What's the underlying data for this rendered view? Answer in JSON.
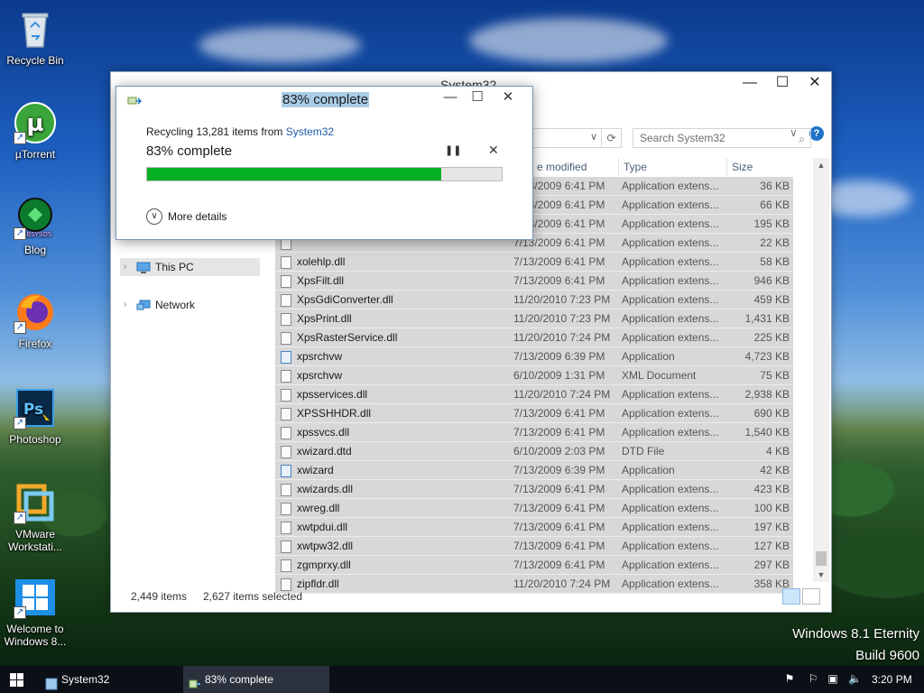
{
  "desktop": {
    "icons": [
      {
        "label": "Recycle Bin",
        "icon": "recycle-bin-icon"
      },
      {
        "label": "µTorrent",
        "icon": "utorrent-icon",
        "badge": "µ"
      },
      {
        "label": "Blog",
        "icon": "blog-icon",
        "badge": "LABSYSOS"
      },
      {
        "label": "Firefox",
        "icon": "firefox-icon"
      },
      {
        "label": "Photoshop",
        "icon": "photoshop-icon",
        "badge": "Ps"
      },
      {
        "label": "VMware Workstati...",
        "icon": "vmware-icon"
      },
      {
        "label": "Welcome to Windows 8...",
        "icon": "windows-welcome-icon"
      }
    ],
    "watermark": {
      "line1": "Windows 8.1 Eternity",
      "line2": "Build 9600"
    }
  },
  "explorer": {
    "title": "System32",
    "search_placeholder": "Search System32",
    "help_label": "?",
    "columns": {
      "date": "e modified",
      "type": "Type",
      "size": "Size"
    },
    "nav": [
      {
        "label": "This PC",
        "selected": true,
        "icon": "this-pc-icon"
      },
      {
        "label": "Network",
        "selected": false,
        "icon": "network-icon"
      }
    ],
    "files": [
      {
        "name": "",
        "date": "7/13/2009 6:41 PM",
        "type": "Application extens...",
        "size": "36 KB",
        "icon": "dll"
      },
      {
        "name": "",
        "date": "7/13/2009 6:41 PM",
        "type": "Application extens...",
        "size": "66 KB",
        "icon": "dll"
      },
      {
        "name": "",
        "date": "7/13/2009 6:41 PM",
        "type": "Application extens...",
        "size": "195 KB",
        "icon": "dll"
      },
      {
        "name": "",
        "date": "7/13/2009 6:41 PM",
        "type": "Application extens...",
        "size": "22 KB",
        "icon": "dll"
      },
      {
        "name": "xolehlp.dll",
        "date": "7/13/2009 6:41 PM",
        "type": "Application extens...",
        "size": "58 KB",
        "icon": "dll"
      },
      {
        "name": "XpsFilt.dll",
        "date": "7/13/2009 6:41 PM",
        "type": "Application extens...",
        "size": "946 KB",
        "icon": "dll"
      },
      {
        "name": "XpsGdiConverter.dll",
        "date": "11/20/2010 7:23 PM",
        "type": "Application extens...",
        "size": "459 KB",
        "icon": "dll"
      },
      {
        "name": "XpsPrint.dll",
        "date": "11/20/2010 7:23 PM",
        "type": "Application extens...",
        "size": "1,431 KB",
        "icon": "dll"
      },
      {
        "name": "XpsRasterService.dll",
        "date": "11/20/2010 7:24 PM",
        "type": "Application extens...",
        "size": "225 KB",
        "icon": "dll"
      },
      {
        "name": "xpsrchvw",
        "date": "7/13/2009 6:39 PM",
        "type": "Application",
        "size": "4,723 KB",
        "icon": "app"
      },
      {
        "name": "xpsrchvw",
        "date": "6/10/2009 1:31 PM",
        "type": "XML Document",
        "size": "75 KB",
        "icon": "xml"
      },
      {
        "name": "xpsservices.dll",
        "date": "11/20/2010 7:24 PM",
        "type": "Application extens...",
        "size": "2,938 KB",
        "icon": "dll"
      },
      {
        "name": "XPSSHHDR.dll",
        "date": "7/13/2009 6:41 PM",
        "type": "Application extens...",
        "size": "690 KB",
        "icon": "dll"
      },
      {
        "name": "xpssvcs.dll",
        "date": "7/13/2009 6:41 PM",
        "type": "Application extens...",
        "size": "1,540 KB",
        "icon": "dll"
      },
      {
        "name": "xwizard.dtd",
        "date": "6/10/2009 2:03 PM",
        "type": "DTD File",
        "size": "4 KB",
        "icon": "file"
      },
      {
        "name": "xwizard",
        "date": "7/13/2009 6:39 PM",
        "type": "Application",
        "size": "42 KB",
        "icon": "app"
      },
      {
        "name": "xwizards.dll",
        "date": "7/13/2009 6:41 PM",
        "type": "Application extens...",
        "size": "423 KB",
        "icon": "dll"
      },
      {
        "name": "xwreg.dll",
        "date": "7/13/2009 6:41 PM",
        "type": "Application extens...",
        "size": "100 KB",
        "icon": "dll"
      },
      {
        "name": "xwtpdui.dll",
        "date": "7/13/2009 6:41 PM",
        "type": "Application extens...",
        "size": "197 KB",
        "icon": "dll"
      },
      {
        "name": "xwtpw32.dll",
        "date": "7/13/2009 6:41 PM",
        "type": "Application extens...",
        "size": "127 KB",
        "icon": "dll"
      },
      {
        "name": "zgmprxy.dll",
        "date": "7/13/2009 6:41 PM",
        "type": "Application extens...",
        "size": "297 KB",
        "icon": "dll"
      },
      {
        "name": "zipfldr.dll",
        "date": "11/20/2010 7:24 PM",
        "type": "Application extens...",
        "size": "358 KB",
        "icon": "dll"
      }
    ],
    "status": {
      "items": "2,449 items",
      "selected": "2,627 items selected"
    }
  },
  "dialog": {
    "title": "83% complete",
    "subtitle_prefix": "Recycling 13,281 items from ",
    "subtitle_source": "System32",
    "percent_text": "83% complete",
    "progress": 0.83,
    "more_details": "More details",
    "progress_color": "#06b025"
  },
  "taskbar": {
    "items": [
      {
        "label": "System32",
        "active": false
      },
      {
        "label": "83% complete",
        "active": true
      }
    ],
    "clock": "3:20 PM"
  }
}
